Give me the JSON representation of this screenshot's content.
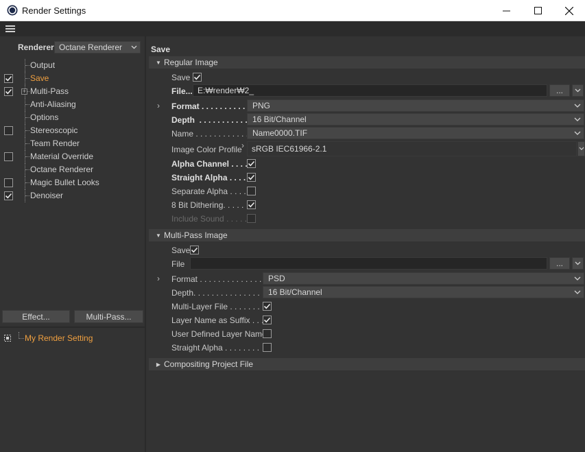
{
  "window": {
    "title": "Render Settings"
  },
  "left": {
    "renderer_label": "Renderer",
    "renderer_value": "Octane Renderer",
    "tree": [
      {
        "label": "Output",
        "checked": null,
        "active": false
      },
      {
        "label": "Save",
        "checked": true,
        "active": true
      },
      {
        "label": "Multi-Pass",
        "checked": true,
        "active": false
      },
      {
        "label": "Anti-Aliasing",
        "checked": null,
        "active": false
      },
      {
        "label": "Options",
        "checked": null,
        "active": false
      },
      {
        "label": "Stereoscopic",
        "checked": false,
        "active": false
      },
      {
        "label": "Team Render",
        "checked": null,
        "active": false
      },
      {
        "label": "Material Override",
        "checked": false,
        "active": false
      },
      {
        "label": "Octane Renderer",
        "checked": null,
        "active": false
      },
      {
        "label": "Magic Bullet Looks",
        "checked": false,
        "active": false
      },
      {
        "label": "Denoiser",
        "checked": true,
        "active": false
      }
    ],
    "effect_button": "Effect...",
    "multipass_button": "Multi-Pass...",
    "setting_name": "My Render Setting"
  },
  "right": {
    "page_title": "Save",
    "regular": {
      "header": "Regular Image",
      "save_label": "Save",
      "save_checked": true,
      "file_label": "File...",
      "file_value": "E:₩render₩2_",
      "file_btn": "...",
      "format_label": "Format . . . . . . . . . . .",
      "format_value": "PNG",
      "depth_label": "Depth  . . . . . . . . . . .",
      "depth_value": "16 Bit/Channel",
      "name_label": "Name . . . . . . . . . . . .",
      "name_value": "Name0000.TIF",
      "profile_label": "Image Color Profile",
      "profile_value": "sRGB IEC61966-2.1",
      "alpha_label": "Alpha Channel . . . .",
      "alpha_checked": true,
      "straight_label": "Straight Alpha . . . .",
      "straight_checked": true,
      "separate_label": "Separate Alpha . . . .",
      "separate_checked": false,
      "dither_label": "8 Bit Dithering. . . . .",
      "dither_checked": true,
      "sound_label": "Include Sound . . . . .",
      "sound_checked": false
    },
    "multipass": {
      "header": "Multi-Pass Image",
      "save_label": "Save",
      "save_checked": true,
      "file_label": "File",
      "file_value": "",
      "file_btn": "...",
      "format_label": "Format . . . . . . . . . . . . . .",
      "format_value": "PSD",
      "depth_label": "Depth. . . . . . . . . . . . . . .",
      "depth_value": "16 Bit/Channel",
      "multilayer_label": "Multi-Layer File . . . . . . .",
      "multilayer_checked": true,
      "suffix_label": "Layer Name as Suffix . . .",
      "suffix_checked": true,
      "userdef_label": "User Defined Layer Name",
      "userdef_checked": false,
      "straight_label": "Straight Alpha . . . . . . . .",
      "straight_checked": false
    },
    "compositing": {
      "header": "Compositing Project File"
    }
  },
  "colors": {
    "accent": "#f0a040",
    "panel": "#333333",
    "header": "#3e3e3e"
  }
}
